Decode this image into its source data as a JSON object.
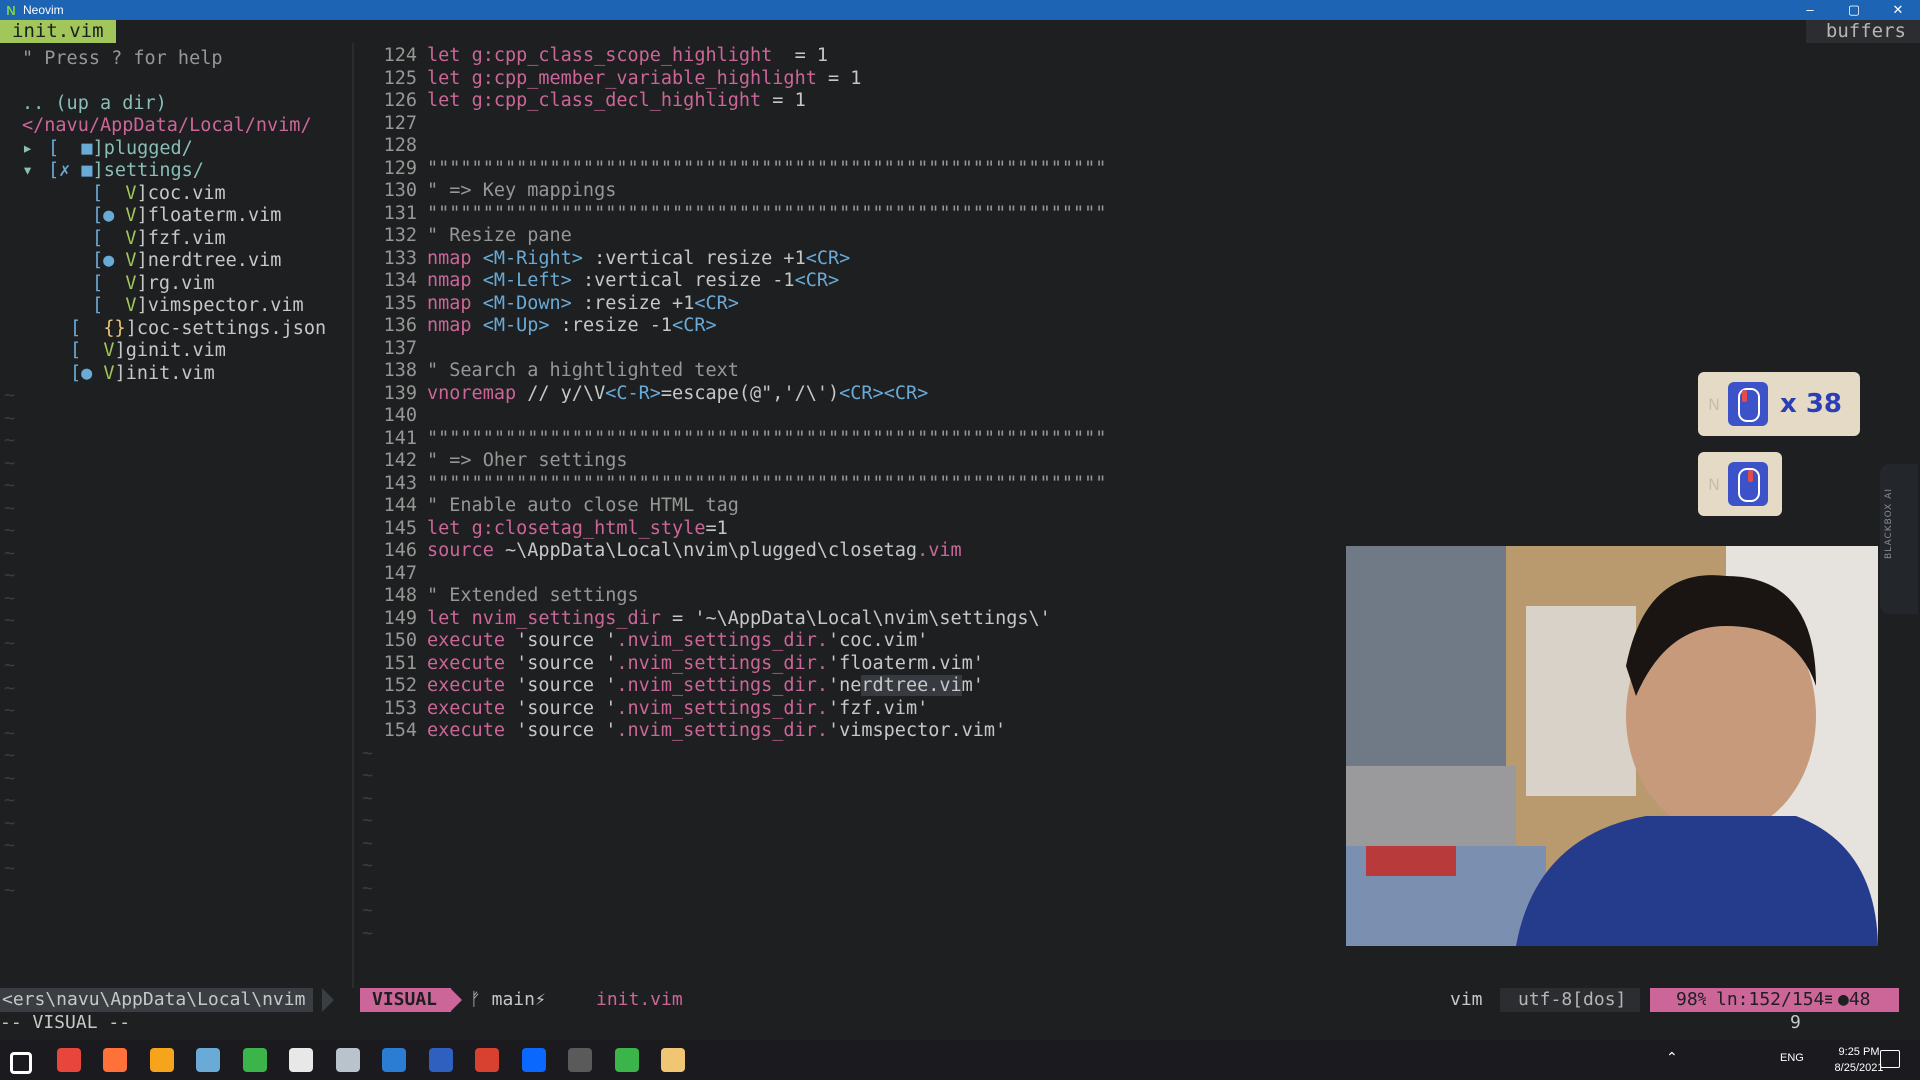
{
  "window": {
    "title": "Neovim",
    "controls": [
      "–",
      "▢",
      "✕"
    ]
  },
  "tabline": {
    "active_tab": "init.vim",
    "right_label": "buffers"
  },
  "tree": {
    "lines": [
      {
        "indent": "",
        "text": "\" Press ? for help",
        "cls": "c-comment",
        "ln": 1
      },
      {
        "indent": "",
        "text": ".. (up a dir)",
        "cls": "c-dir",
        "ln": 3
      },
      {
        "indent": "",
        "text": "</navu/AppData/Local/nvim/",
        "cls": "c-path",
        "ln": 4
      }
    ],
    "entries": [
      {
        "arrow": "▸",
        "prefix": "[  ",
        "icon": "■",
        "icon_cls": "c-blue",
        "name": "]plugged/",
        "name_cls": "c-dir",
        "ln": 5,
        "level": 0
      },
      {
        "arrow": "▾",
        "prefix": "[✗ ",
        "icon": "■",
        "icon_cls": "c-blue",
        "name": "]settings/",
        "name_cls": "c-dir",
        "ln": 6,
        "level": 0
      },
      {
        "arrow": "",
        "prefix": "[  ",
        "icon": "V",
        "icon_cls": "c-green",
        "name": "]coc.vim",
        "name_cls": "c-file",
        "ln": 7,
        "level": 2
      },
      {
        "arrow": "",
        "prefix": "[● ",
        "icon": "V",
        "icon_cls": "c-green",
        "name": "]floaterm.vim",
        "name_cls": "c-file",
        "ln": 8,
        "level": 2
      },
      {
        "arrow": "",
        "prefix": "[  ",
        "icon": "V",
        "icon_cls": "c-green",
        "name": "]fzf.vim",
        "name_cls": "c-file",
        "ln": 9,
        "level": 2
      },
      {
        "arrow": "",
        "prefix": "[● ",
        "icon": "V",
        "icon_cls": "c-green",
        "name": "]nerdtree.vim",
        "name_cls": "c-file",
        "ln": 10,
        "level": 2
      },
      {
        "arrow": "",
        "prefix": "[  ",
        "icon": "V",
        "icon_cls": "c-green",
        "name": "]rg.vim",
        "name_cls": "c-file",
        "ln": 11,
        "level": 2
      },
      {
        "arrow": "",
        "prefix": "[  ",
        "icon": "V",
        "icon_cls": "c-green",
        "name": "]vimspector.vim",
        "name_cls": "c-file",
        "ln": 12,
        "level": 2
      },
      {
        "arrow": "",
        "prefix": "[  ",
        "icon": "{}",
        "icon_cls": "c-yellow",
        "name": "]coc-settings.json",
        "name_cls": "c-file",
        "ln": 13,
        "level": 1
      },
      {
        "arrow": "",
        "prefix": "[  ",
        "icon": "V",
        "icon_cls": "c-green",
        "name": "]ginit.vim",
        "name_cls": "c-file",
        "ln": 14,
        "level": 1
      },
      {
        "arrow": "",
        "prefix": "[● ",
        "icon": "V",
        "icon_cls": "c-green",
        "name": "]init.vim",
        "name_cls": "c-file",
        "ln": 15,
        "level": 1
      }
    ]
  },
  "code": [
    {
      "n": "124",
      "t": [
        [
          "kw",
          "let "
        ],
        [
          "var",
          "g:cpp_class_scope_highlight"
        ],
        [
          "",
          "  = 1"
        ]
      ]
    },
    {
      "n": "125",
      "t": [
        [
          "kw",
          "let "
        ],
        [
          "var",
          "g:cpp_member_variable_highlight"
        ],
        [
          "",
          " = 1"
        ]
      ]
    },
    {
      "n": "126",
      "t": [
        [
          "kw",
          "let "
        ],
        [
          "var",
          "g:cpp_class_decl_highlight"
        ],
        [
          "",
          " = 1"
        ]
      ]
    },
    {
      "n": "127",
      "t": []
    },
    {
      "n": "128",
      "t": []
    },
    {
      "n": "129",
      "t": [
        [
          "cmt",
          "\"\"\"\"\"\"\"\"\"\"\"\"\"\"\"\"\"\"\"\"\"\"\"\"\"\"\"\"\"\"\"\"\"\"\"\"\"\"\"\"\"\"\"\"\"\"\"\"\"\"\"\"\"\"\"\"\"\"\"\"\""
        ]
      ]
    },
    {
      "n": "130",
      "t": [
        [
          "cmt",
          "\" => Key mappings"
        ]
      ]
    },
    {
      "n": "131",
      "t": [
        [
          "cmt",
          "\"\"\"\"\"\"\"\"\"\"\"\"\"\"\"\"\"\"\"\"\"\"\"\"\"\"\"\"\"\"\"\"\"\"\"\"\"\"\"\"\"\"\"\"\"\"\"\"\"\"\"\"\"\"\"\"\"\"\"\"\""
        ]
      ]
    },
    {
      "n": "132",
      "t": [
        [
          "cmt",
          "\" Resize pane"
        ]
      ]
    },
    {
      "n": "133",
      "t": [
        [
          "kw",
          "nmap "
        ],
        [
          "ang",
          "<M-Right>"
        ],
        [
          "",
          " :vertical resize +1"
        ],
        [
          "ang",
          "<CR>"
        ]
      ]
    },
    {
      "n": "134",
      "t": [
        [
          "kw",
          "nmap "
        ],
        [
          "ang",
          "<M-Left>"
        ],
        [
          "",
          " :vertical resize -1"
        ],
        [
          "ang",
          "<CR>"
        ]
      ]
    },
    {
      "n": "135",
      "t": [
        [
          "kw",
          "nmap "
        ],
        [
          "ang",
          "<M-Down>"
        ],
        [
          "",
          " :resize +1"
        ],
        [
          "ang",
          "<CR>"
        ]
      ]
    },
    {
      "n": "136",
      "t": [
        [
          "kw",
          "nmap "
        ],
        [
          "ang",
          "<M-Up>"
        ],
        [
          "",
          " :resize -1"
        ],
        [
          "ang",
          "<CR>"
        ]
      ]
    },
    {
      "n": "137",
      "t": []
    },
    {
      "n": "138",
      "t": [
        [
          "cmt",
          "\" Search a hightlighted text"
        ]
      ]
    },
    {
      "n": "139",
      "t": [
        [
          "kw",
          "vnoremap "
        ],
        [
          "",
          "// y/\\V"
        ],
        [
          "ang",
          "<C-R>"
        ],
        [
          "",
          "=escape(@\",'/\\')"
        ],
        [
          "ang",
          "<CR><CR>"
        ]
      ]
    },
    {
      "n": "140",
      "t": []
    },
    {
      "n": "141",
      "t": [
        [
          "cmt",
          "\"\"\"\"\"\"\"\"\"\"\"\"\"\"\"\"\"\"\"\"\"\"\"\"\"\"\"\"\"\"\"\"\"\"\"\"\"\"\"\"\"\"\"\"\"\"\"\"\"\"\"\"\"\"\"\"\"\"\"\"\""
        ]
      ]
    },
    {
      "n": "142",
      "t": [
        [
          "cmt",
          "\" => Oher settings"
        ]
      ]
    },
    {
      "n": "143",
      "t": [
        [
          "cmt",
          "\"\"\"\"\"\"\"\"\"\"\"\"\"\"\"\"\"\"\"\"\"\"\"\"\"\"\"\"\"\"\"\"\"\"\"\"\"\"\"\"\"\"\"\"\"\"\"\"\"\"\"\"\"\"\"\"\"\"\"\"\""
        ]
      ]
    },
    {
      "n": "144",
      "t": [
        [
          "cmt",
          "\" Enable auto close HTML tag"
        ]
      ]
    },
    {
      "n": "145",
      "t": [
        [
          "kw",
          "let "
        ],
        [
          "var",
          "g:closetag_html_style"
        ],
        [
          "",
          "=1"
        ]
      ]
    },
    {
      "n": "146",
      "t": [
        [
          "kw",
          "source "
        ],
        [
          "",
          "~\\AppData\\Local\\nvim\\plugged\\closetag"
        ],
        [
          "kw",
          ".vim"
        ]
      ]
    },
    {
      "n": "147",
      "t": []
    },
    {
      "n": "148",
      "t": [
        [
          "cmt",
          "\" Extended settings"
        ]
      ]
    },
    {
      "n": "149",
      "t": [
        [
          "kw",
          "let "
        ],
        [
          "var",
          "nvim_settings_dir"
        ],
        [
          "",
          " = "
        ],
        [
          "strf",
          "'~\\AppData\\Local\\nvim\\settings\\'"
        ]
      ]
    },
    {
      "n": "150",
      "t": [
        [
          "kw",
          "execute "
        ],
        [
          "strf",
          "'source '"
        ],
        [
          "var",
          ".nvim_settings_dir."
        ],
        [
          "strf",
          "'coc.vim'"
        ]
      ]
    },
    {
      "n": "151",
      "t": [
        [
          "kw",
          "execute "
        ],
        [
          "strf",
          "'source '"
        ],
        [
          "var",
          ".nvim_settings_dir."
        ],
        [
          "strf",
          "'floaterm.vim'"
        ]
      ]
    },
    {
      "n": "152",
      "t": [
        [
          "kw",
          "execute "
        ],
        [
          "strf",
          "'source '"
        ],
        [
          "var",
          ".nvim_settings_dir."
        ],
        [
          "strf",
          "'ne"
        ],
        [
          "sel",
          "rdtree.vi"
        ],
        [
          "strf",
          "m'"
        ]
      ]
    },
    {
      "n": "153",
      "t": [
        [
          "kw",
          "execute "
        ],
        [
          "strf",
          "'source '"
        ],
        [
          "var",
          ".nvim_settings_dir."
        ],
        [
          "strf",
          "'fzf.vim'"
        ]
      ]
    },
    {
      "n": "154",
      "t": [
        [
          "kw",
          "execute "
        ],
        [
          "strf",
          "'source '"
        ],
        [
          "var",
          ".nvim_settings_dir."
        ],
        [
          "strf",
          "'vimspector.vim'"
        ]
      ]
    }
  ],
  "key_overlay": {
    "badge": "N",
    "count_label": "x 38"
  },
  "blackbox": {
    "label": "BLACKBOX AI"
  },
  "statusline": {
    "path": "<ers\\navu\\AppData\\Local\\nvim",
    "mode": "VISUAL",
    "branch": "ᚠ main⚡",
    "file": "init.vim",
    "filetype": "vim",
    "encoding": "utf-8[dos]",
    "percent": "98%",
    "position": "ln:152/154≡",
    "extra": "●48"
  },
  "cmdline": {
    "text": "-- VISUAL --",
    "right": "9"
  },
  "taskbar": {
    "lang": "ENG",
    "time": "9:25 PM",
    "date": "8/25/2021",
    "icons": [
      "windows-start",
      "chrome",
      "firefox",
      "xampp",
      "sourcetree",
      "maps",
      "git",
      "steam",
      "docs",
      "outlook",
      "filezilla",
      "zalo",
      "obs",
      "neovim",
      "media"
    ]
  },
  "colors": {
    "accent_green": "#a1c659",
    "accent_pink": "#cc6699",
    "title_blue": "#1e64b4"
  }
}
